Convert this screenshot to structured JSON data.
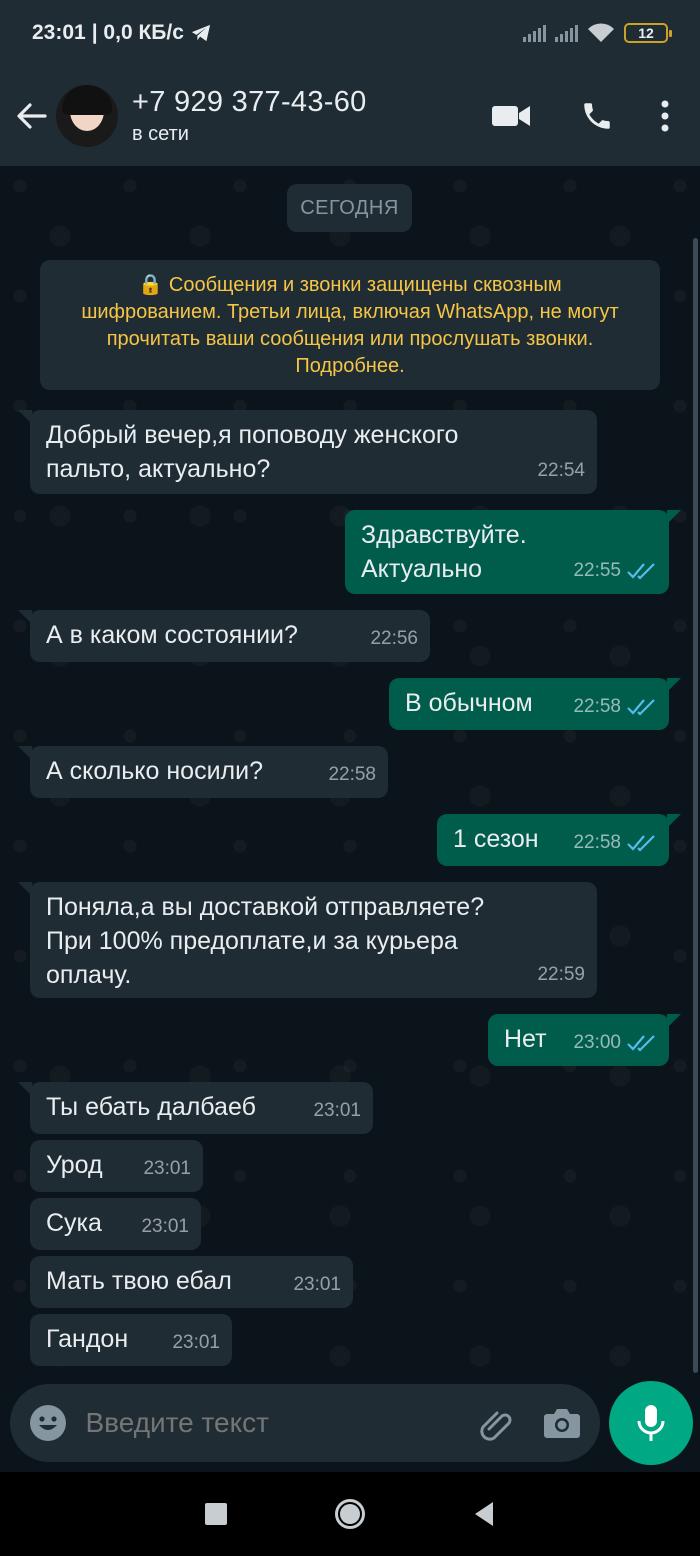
{
  "status_bar": {
    "time": "23:01",
    "speed": "| 0,0 КБ/с",
    "battery": "12"
  },
  "header": {
    "contact_name": "+7 929 377-43-60",
    "contact_status": "в сети"
  },
  "chat": {
    "date_label": "СЕГОДНЯ",
    "encryption_notice": "🔒 Сообщения и звонки защищены сквозным шифрованием. Третьи лица, включая WhatsApp, не могут прочитать ваши сообщения или прослушать звонки. Подробнее.",
    "messages": [
      {
        "dir": "in",
        "text": "Добрый вечер,я поповоду женского\nпальто, актуально?",
        "time": "22:54"
      },
      {
        "dir": "out",
        "text": "Здравствуйте.\nАктуально",
        "time": "22:55",
        "read": true
      },
      {
        "dir": "in",
        "text": "А в каком состоянии?",
        "time": "22:56"
      },
      {
        "dir": "out",
        "text": "В обычном",
        "time": "22:58",
        "read": true
      },
      {
        "dir": "in",
        "text": "А сколько носили?",
        "time": "22:58"
      },
      {
        "dir": "out",
        "text": "1 сезон",
        "time": "22:58",
        "read": true
      },
      {
        "dir": "in",
        "text": "Поняла,а вы доставкой отправляете?\nПри 100% предоплате,и за курьера\nоплачу.",
        "time": "22:59"
      },
      {
        "dir": "out",
        "text": "Нет",
        "time": "23:00",
        "read": true
      },
      {
        "dir": "in",
        "text": "Ты ебать далбаеб",
        "time": "23:01"
      },
      {
        "dir": "in",
        "text": "Урод",
        "time": "23:01"
      },
      {
        "dir": "in",
        "text": "Сука",
        "time": "23:01"
      },
      {
        "dir": "in",
        "text": "Мать твою ебал",
        "time": "23:01"
      },
      {
        "dir": "in",
        "text": "Гандон",
        "time": "23:01"
      }
    ]
  },
  "input": {
    "placeholder": "Введите текст"
  },
  "colors": {
    "header": "#1f2c34",
    "incoming": "#1f2c34",
    "outgoing": "#005c4b",
    "accent": "#00a884",
    "read_ticks": "#53bdeb"
  }
}
